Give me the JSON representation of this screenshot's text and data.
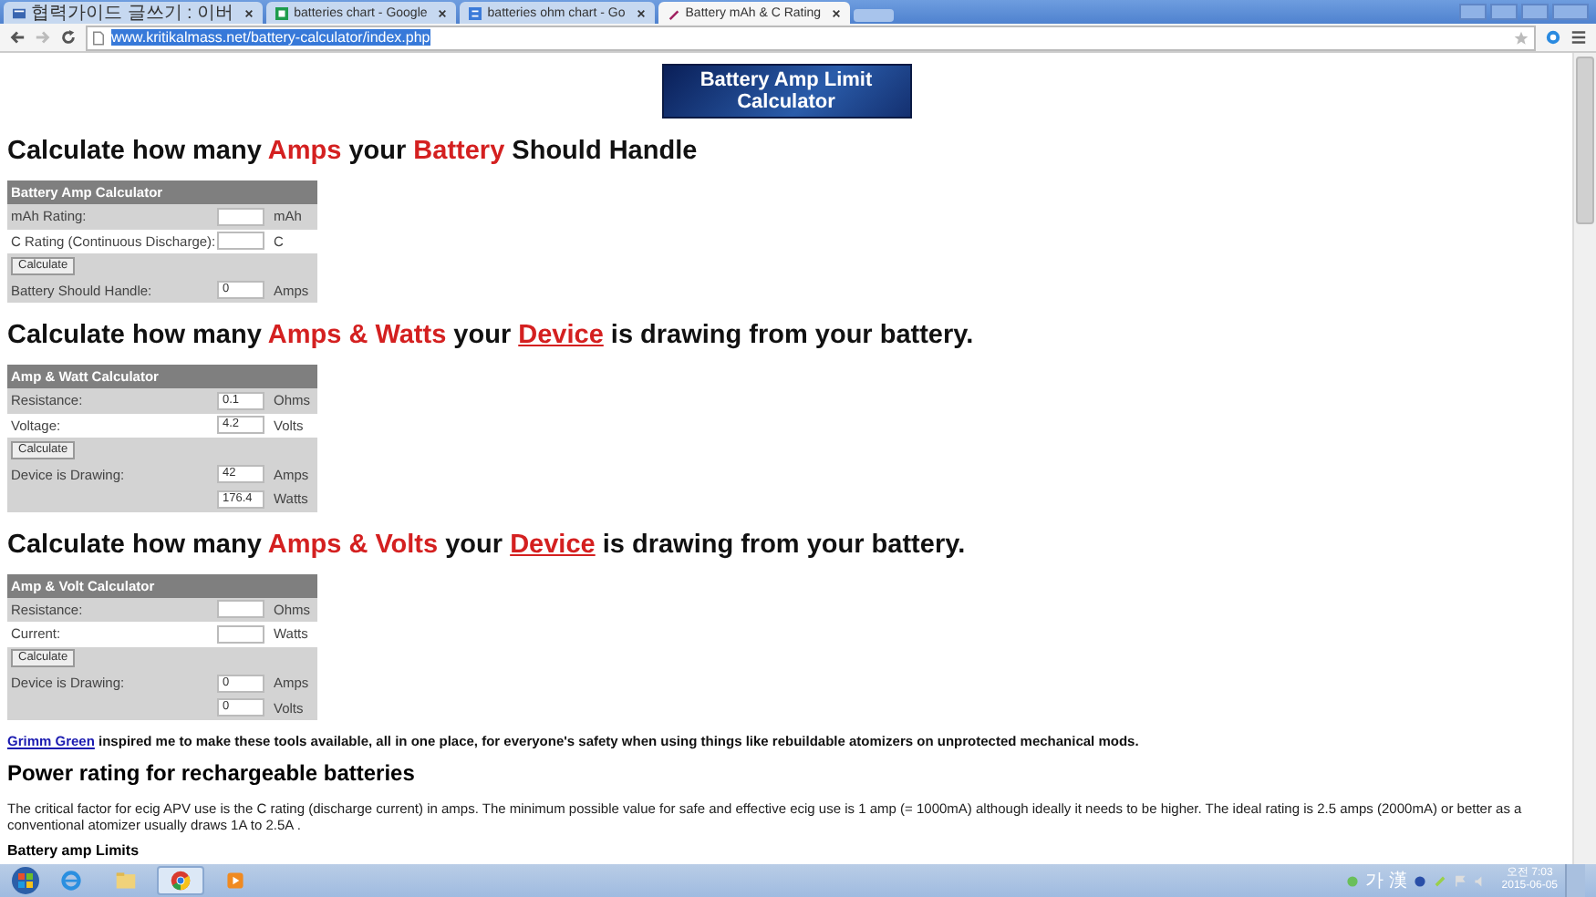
{
  "browser": {
    "tabs": [
      {
        "title": "협력가이드 글쓰기 : 이버",
        "kind": "blog",
        "selected": false
      },
      {
        "title": "batteries chart - Google",
        "kind": "sheet",
        "selected": false
      },
      {
        "title": "batteries ohm chart - Go",
        "kind": "search",
        "selected": false
      },
      {
        "title": "Battery mAh & C Rating",
        "kind": "battery",
        "selected": true
      }
    ],
    "address": "www.kritikalmass.net/battery-calculator/index.php"
  },
  "page": {
    "logo": "Battery Amp Limit Calculator",
    "sections": [
      {
        "heading": [
          {
            "text": "Calculate how many ",
            "kind": "plain"
          },
          {
            "text": "Amps",
            "kind": "red"
          },
          {
            "text": " your ",
            "kind": "plain"
          },
          {
            "text": "Battery",
            "kind": "red"
          },
          {
            "text": " Should Handle",
            "kind": "plain"
          }
        ],
        "calculator": {
          "title": "Battery Amp Calculator",
          "rows": [
            {
              "kind": "input",
              "label": "mAh Rating:",
              "unit": "mAh",
              "shaded": true
            },
            {
              "kind": "input",
              "label": "C Rating (Continuous Discharge):",
              "unit": "C",
              "shaded": false
            },
            {
              "kind": "button",
              "label": "Calculate",
              "shaded": true
            },
            {
              "kind": "input",
              "label": "Battery Should Handle:",
              "value": "0",
              "unit": "Amps",
              "shaded": true
            }
          ]
        }
      },
      {
        "heading": [
          {
            "text": "Calculate how many ",
            "kind": "plain"
          },
          {
            "text": "Amps & Watts",
            "kind": "red"
          },
          {
            "text": " your ",
            "kind": "plain"
          },
          {
            "text": "Device",
            "kind": "link"
          },
          {
            "text": " is drawing from your battery.",
            "kind": "plain"
          }
        ],
        "calculator": {
          "title": "Amp & Watt Calculator",
          "rows": [
            {
              "kind": "input",
              "label": "Resistance:",
              "value": "0.1",
              "unit": "Ohms",
              "shaded": true
            },
            {
              "kind": "input",
              "label": "Voltage:",
              "value": "4.2",
              "unit": "Volts",
              "shaded": false
            },
            {
              "kind": "button",
              "label": "Calculate",
              "shaded": true
            },
            {
              "kind": "input",
              "label": "Device is Drawing:",
              "value": "42",
              "unit": "Amps",
              "shaded": true
            },
            {
              "kind": "input",
              "value": "176.4",
              "unit": "Watts",
              "shaded": true
            }
          ]
        }
      },
      {
        "heading": [
          {
            "text": "Calculate how many ",
            "kind": "plain"
          },
          {
            "text": "Amps & Volts",
            "kind": "red"
          },
          {
            "text": " your ",
            "kind": "plain"
          },
          {
            "text": "Device",
            "kind": "link"
          },
          {
            "text": " is drawing from your battery.",
            "kind": "plain"
          }
        ],
        "calculator": {
          "title": "Amp & Volt Calculator",
          "rows": [
            {
              "kind": "input",
              "label": "Resistance:",
              "unit": "Ohms",
              "shaded": true
            },
            {
              "kind": "input",
              "label": "Current:",
              "unit": "Watts",
              "shaded": false
            },
            {
              "kind": "button",
              "label": "Calculate",
              "shaded": true
            },
            {
              "kind": "input",
              "label": "Device is Drawing:",
              "value": "0",
              "unit": "Amps",
              "shaded": true
            },
            {
              "kind": "input",
              "value": "0",
              "unit": "Volts",
              "shaded": true
            }
          ]
        }
      }
    ],
    "credit": {
      "link": "Grimm Green",
      "text": " inspired me to make these tools available, all in one place, for everyone's safety when using things like rebuildable atomizers on unprotected mechanical mods."
    },
    "power_heading": "Power rating for rechargeable batteries",
    "power_text": "The critical factor for ecig APV use is the C rating (discharge current) in amps. The minimum possible value for safe and effective ecig use is 1 amp (= 1000mA) although ideally it needs to be higher. The ideal rating is 2.5 amps (2000mA) or better as a conventional atomizer usually draws 1A to 2.5A .",
    "limits_heading": "Battery amp Limits"
  },
  "taskbar": {
    "apps": [
      {
        "kind": "ie",
        "selected": false
      },
      {
        "kind": "folder",
        "selected": false
      },
      {
        "kind": "chrome",
        "selected": true
      },
      {
        "kind": "media",
        "selected": false
      }
    ],
    "ime": "가 漢",
    "time": "오전 7:03",
    "date": "2015-06-05"
  }
}
